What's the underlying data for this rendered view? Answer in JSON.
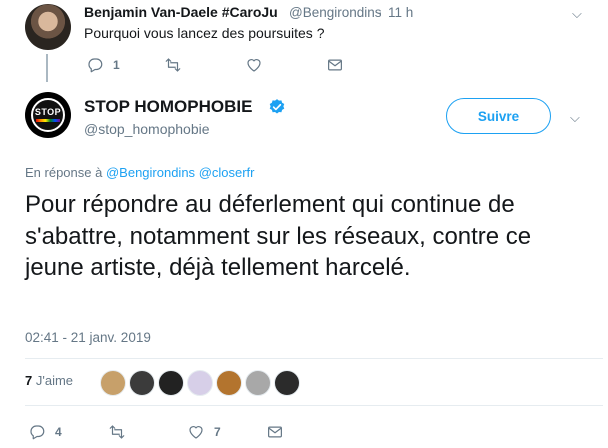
{
  "reply_tweet": {
    "author_name": "Benjamin Van-Daele #CaroJu",
    "author_handle": "@Bengirondins",
    "separator": "·",
    "time": "11 h",
    "text": "Pourquoi vous lancez des poursuites ?",
    "reply_count": "1"
  },
  "main_tweet": {
    "author_name": "STOP HOMOPHOBIE",
    "author_handle": "@stop_homophobie",
    "avatar_logo": {
      "word": "STOP",
      "sub": "HOMOPHOBIE"
    },
    "follow_label": "Suivre",
    "in_reply_prefix": "En réponse à",
    "in_reply_users": [
      "@Bengirondins",
      "@closerfr"
    ],
    "text": "Pour répondre au déferlement qui continue de s'abattre, notamment sur les réseaux, contre ce jeune artiste, déjà tellement harcelé.",
    "timestamp": "02:41 - 21 janv. 2019",
    "likes_count": "7",
    "likes_label": "J'aime",
    "liker_avatar_colors": [
      "#c7a06a",
      "#3b3b3b",
      "#222222",
      "#d7cfe8",
      "#b3742e",
      "#a8a8a8",
      "#2b2b2b"
    ],
    "reply_count": "4",
    "like_count_action": "7"
  },
  "colors": {
    "link": "#1da1f2",
    "muted": "#657786",
    "text": "#14171a",
    "verified": "#1da1f2"
  },
  "icons": [
    "reply-icon",
    "retweet-icon",
    "like-icon",
    "dm-icon",
    "chevron-down-icon",
    "verified-badge-icon"
  ]
}
